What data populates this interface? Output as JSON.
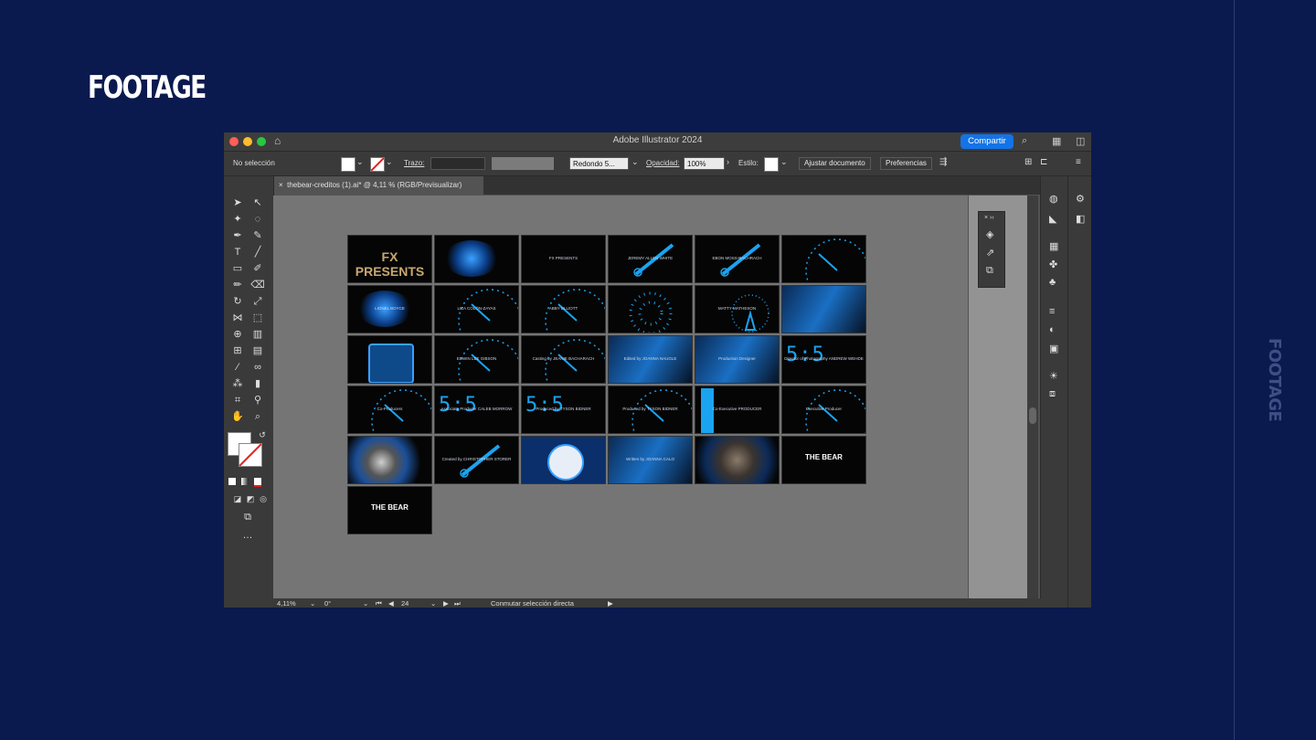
{
  "slide": {
    "title": "FOOTAGE",
    "side_label": "FOOTAGE"
  },
  "app": {
    "window_title": "Adobe Illustrator 2024",
    "share_button": "Compartir",
    "colors": {
      "share_button": "#1473e6",
      "traffic_red": "#ff5f57",
      "traffic_yellow": "#febc2e",
      "traffic_green": "#28c840"
    }
  },
  "control_bar": {
    "selection_label": "No selección",
    "stroke_label": "Trazo:",
    "brush_label": "Redondo 5...",
    "opacity_label": "Opacidad:",
    "opacity_value": "100%",
    "style_label": "Estilo:",
    "adjust_document_button": "Ajustar documento",
    "preferences_button": "Preferencias"
  },
  "document_tab": {
    "label": "thebear-creditos (1).ai* @ 4,11 % (RGB/Previsualizar)"
  },
  "status_bar": {
    "zoom": "4,11%",
    "rotation": "0°",
    "artboard_number": "24",
    "status_text": "Conmutar selección directa"
  },
  "artboards": [
    {
      "caption": "FX PRESENTS",
      "kind": "text-photo"
    },
    {
      "caption": "",
      "kind": "glow"
    },
    {
      "caption": "FX PRESENTS",
      "kind": "plain"
    },
    {
      "caption": "JEREMY ALLEN WHITE",
      "kind": "knife"
    },
    {
      "caption": "EBON MOSS-BACHRACH",
      "kind": "knife"
    },
    {
      "caption": "",
      "kind": "dial"
    },
    {
      "caption": "LIONEL BOYCE",
      "kind": "glow"
    },
    {
      "caption": "LIZA COLÓN-ZAYAS",
      "kind": "dial"
    },
    {
      "caption": "ABBY ELLIOTT",
      "kind": "dial"
    },
    {
      "caption": "",
      "kind": "dots"
    },
    {
      "caption": "MATTY MATHESON",
      "kind": "wheel"
    },
    {
      "caption": "",
      "kind": "photo"
    },
    {
      "caption": "",
      "kind": "clock"
    },
    {
      "caption": "EDWIN LEE GIBSON",
      "kind": "dial"
    },
    {
      "caption": "Casting by JEANIE BACHARACH",
      "kind": "dial"
    },
    {
      "caption": "Edited by JOANNA NAUGLE",
      "kind": "photo"
    },
    {
      "caption": "Production Designer",
      "kind": "photo"
    },
    {
      "caption": "Director of Photography ANDREW WEHDE",
      "kind": "digits"
    },
    {
      "caption": "Co-Producers",
      "kind": "dial"
    },
    {
      "caption": "Associate Producer CALEB MORROW",
      "kind": "digits"
    },
    {
      "caption": "Produced by TYSON BIDNER",
      "kind": "digits"
    },
    {
      "caption": "Produced by TYSON BIDNER",
      "kind": "dial"
    },
    {
      "caption": "Co-Executive PRODUCER",
      "kind": "bottle"
    },
    {
      "caption": "Executive Producer",
      "kind": "dial"
    },
    {
      "caption": "",
      "kind": "burner"
    },
    {
      "caption": "Created by CHRISTOPHER STORER",
      "kind": "knife"
    },
    {
      "caption": "",
      "kind": "alarm"
    },
    {
      "caption": "Written by JOANNA CALO",
      "kind": "photo"
    },
    {
      "caption": "",
      "kind": "bear"
    },
    {
      "caption": "THE BEAR",
      "kind": "title"
    },
    {
      "caption": "THE BEAR",
      "kind": "title"
    }
  ]
}
